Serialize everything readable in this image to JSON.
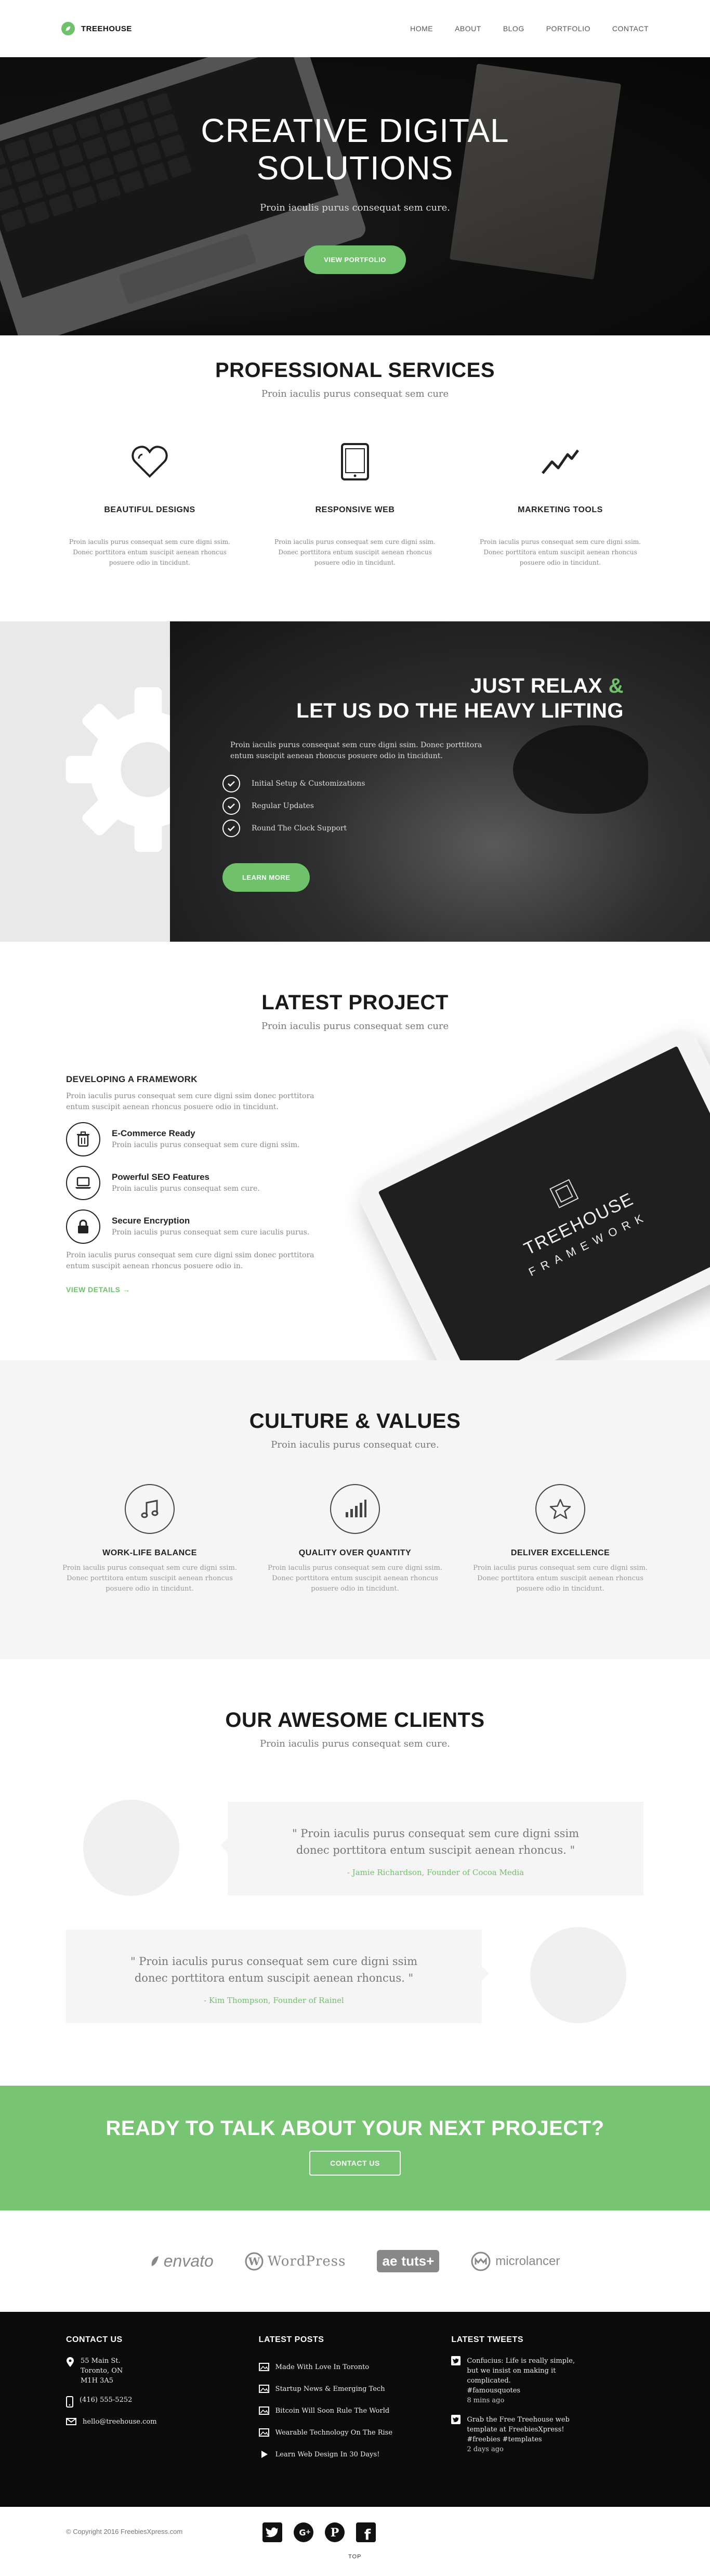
{
  "brand": {
    "name": "TREEHOUSE",
    "accent": "#6fc16b"
  },
  "nav": {
    "items": [
      "HOME",
      "ABOUT",
      "BLOG",
      "PORTFOLIO",
      "CONTACT"
    ]
  },
  "hero": {
    "title_line1": "CREATIVE DIGITAL",
    "title_line2": "SOLUTIONS",
    "subtitle": "Proin iaculis purus consequat sem cure.",
    "button": "VIEW PORTFOLIO"
  },
  "services": {
    "title": "PROFESSIONAL SERVICES",
    "subtitle": "Proin iaculis purus consequat sem cure",
    "items": [
      {
        "icon": "heart-icon",
        "title": "BEAUTIFUL DESIGNS",
        "text": "Proin iaculis purus consequat sem cure digni ssim. Donec porttitora entum suscipit aenean rhoncus posuere odio in tincidunt."
      },
      {
        "icon": "tablet-icon",
        "title": "RESPONSIVE WEB",
        "text": "Proin iaculis purus consequat sem cure digni ssim. Donec porttitora entum suscipit aenean rhoncus posuere odio in tincidunt."
      },
      {
        "icon": "trend-icon",
        "title": "MARKETING TOOLS",
        "text": "Proin iaculis purus consequat sem cure digni ssim. Donec porttitora entum suscipit aenean rhoncus posuere odio in tincidunt."
      }
    ]
  },
  "relax": {
    "title_part1": "JUST RELAX",
    "title_amp": "&",
    "title_line2": "LET US DO THE HEAVY LIFTING",
    "text": "Proin iaculis purus consequat sem cure digni ssim. Donec porttitora entum suscipit aenean rhoncus posuere odio in tincidunt.",
    "checks": [
      "Initial Setup & Customizations",
      "Regular Updates",
      "Round The Clock Support"
    ],
    "button": "LEARN MORE"
  },
  "project": {
    "title": "LATEST PROJECT",
    "subtitle": "Proin iaculis purus consequat sem cure",
    "heading": "DEVELOPING A FRAMEWORK",
    "intro": "Proin iaculis purus consequat sem cure digni ssim donec porttitora entum suscipit aenean rhoncus posuere odio in tincidunt.",
    "features": [
      {
        "icon": "trash-icon",
        "title": "E-Commerce Ready",
        "text": "Proin iaculis purus consequat sem cure digni ssim."
      },
      {
        "icon": "laptop-icon",
        "title": "Powerful SEO Features",
        "text": "Proin iaculis purus consequat sem cure."
      },
      {
        "icon": "lock-icon",
        "title": "Secure Encryption",
        "text": "Proin iaculis purus consequat sem cure iaculis purus."
      }
    ],
    "outro": "Proin iaculis purus consequat sem cure digni ssim donec porttitora entum suscipit aenean rhoncus posuere odio in.",
    "link": "VIEW DETAILS  →",
    "tablet_title": "TREEHOUSE",
    "tablet_sub": "FRAMEWORK"
  },
  "culture": {
    "title": "CULTURE & VALUES",
    "subtitle": "Proin iaculis purus consequat cure.",
    "items": [
      {
        "icon": "music-icon",
        "title": "WORK-LIFE BALANCE",
        "text": "Proin iaculis purus consequat sem cure digni ssim. Donec porttitora entum suscipit aenean rhoncus posuere odio in tincidunt."
      },
      {
        "icon": "signal-icon",
        "title": "QUALITY OVER QUANTITY",
        "text": "Proin iaculis purus consequat sem cure digni ssim. Donec porttitora entum suscipit aenean rhoncus posuere odio in tincidunt."
      },
      {
        "icon": "star-icon",
        "title": "DELIVER EXCELLENCE",
        "text": "Proin iaculis purus consequat sem cure digni ssim. Donec porttitora entum suscipit aenean rhoncus posuere odio in tincidunt."
      }
    ]
  },
  "clients": {
    "title": "OUR AWESOME CLIENTS",
    "subtitle": "Proin iaculis purus consequat sem cure.",
    "testimonials": [
      {
        "quote_line1": "\" Proin iaculis purus consequat sem cure digni ssim",
        "quote_line2": "donec porttitora entum suscipit aenean rhoncus. \"",
        "author": "- Jamie Richardson, Founder of Cocoa Media"
      },
      {
        "quote_line1": "\" Proin iaculis purus consequat sem cure digni ssim",
        "quote_line2": "donec porttitora entum suscipit aenean rhoncus. \"",
        "author": "- Kim Thompson, Founder of Rainel"
      }
    ]
  },
  "cta": {
    "title": "READY TO TALK ABOUT YOUR NEXT PROJECT?",
    "button": "CONTACT US"
  },
  "partners": [
    "envato",
    "WordPress",
    "tuts+",
    "microlancer"
  ],
  "footer": {
    "contact": {
      "title": "CONTACT US",
      "address_line1": "55 Main St.",
      "address_line2": "Toronto, ON",
      "address_line3": "M1H 3A5",
      "phone": "(416) 555-5252",
      "email": "hello@treehouse.com"
    },
    "posts": {
      "title": "LATEST POSTS",
      "items": [
        "Made With Love In Toronto",
        "Startup News & Emerging Tech",
        "Bitcoin Will Soon Rule The World",
        "Wearable Technology On The Rise",
        "Learn Web Design In 30 Days!"
      ]
    },
    "tweets": {
      "title": "LATEST TWEETS",
      "items": [
        {
          "line1": "Confucius: Life is really simple,",
          "line2": "but we insist on making it",
          "line3": "complicated.",
          "line4": "#famousquotes",
          "time": "8 mins ago"
        },
        {
          "line1": "Grab the Free Treehouse web",
          "line2": "template at FreebiesXpress!",
          "line3": "#freebies #templates",
          "line4": "",
          "time": "2 days ago"
        }
      ]
    }
  },
  "bottom": {
    "copyright": "© Copyright 2016 FreebiesXpress.com",
    "totop": "TOP"
  }
}
